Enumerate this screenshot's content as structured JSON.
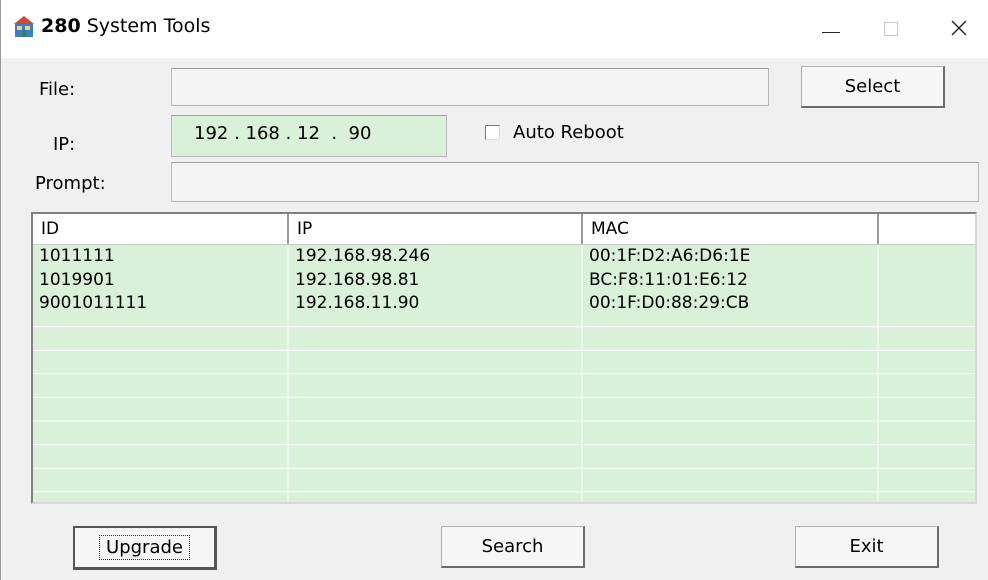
{
  "window": {
    "title_bold": "280",
    "title_rest": " System Tools",
    "minimize_glyph": "—",
    "maximize_glyph": "☐",
    "close_glyph": "✕"
  },
  "form": {
    "file_label": "File:",
    "file_value": "",
    "select_label": "Select",
    "ip_label": "IP:",
    "ip_octets": [
      "192",
      "168",
      "12",
      "90"
    ],
    "ip_display": "192 . 168 . 12  .  90",
    "auto_reboot_label": "Auto Reboot",
    "auto_reboot_checked": false,
    "prompt_label": "Prompt:",
    "prompt_value": ""
  },
  "devices": {
    "columns": [
      "ID",
      "IP",
      "MAC",
      ""
    ],
    "rows": [
      [
        "1011111",
        "192.168.98.246",
        "00:1F:D2:A6:D6:1E",
        ""
      ],
      [
        "1019901",
        "192.168.98.81",
        "BC:F8:11:01:E6:12",
        ""
      ],
      [
        "9001011111",
        "192.168.11.90",
        "00:1F:D0:88:29:CB",
        ""
      ]
    ],
    "row_bg": "#d9f0d9"
  },
  "buttons": {
    "upgrade": "Upgrade",
    "search": "Search",
    "exit": "Exit"
  },
  "icons": {
    "app": "app-icon",
    "minimize": "minimize-icon",
    "maximize": "maximize-icon",
    "close": "close-icon"
  }
}
